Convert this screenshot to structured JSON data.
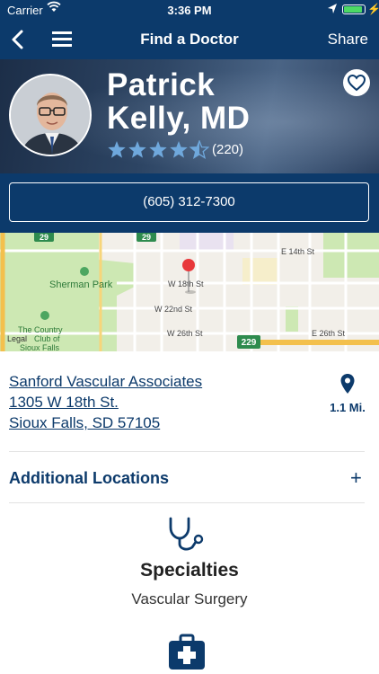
{
  "status_bar": {
    "carrier": "Carrier",
    "time": "3:36 PM"
  },
  "nav": {
    "title": "Find a Doctor",
    "share_label": "Share"
  },
  "doctor": {
    "name_line1": "Patrick",
    "name_line2": "Kelly, MD",
    "rating": 4.5,
    "rating_count": "(220)"
  },
  "phone": "(605) 312-7300",
  "map": {
    "streets": [
      "E 14th St",
      "W 18th St",
      "W 22nd St",
      "W 26th St",
      "E 26th St",
      "Sherman Park",
      "The Country",
      "Club of",
      "Sioux Falls",
      "Legal"
    ],
    "highway_shields": [
      "29",
      "29",
      "229"
    ]
  },
  "location": {
    "name": "Sanford Vascular Associates",
    "street": "1305 W 18th St.",
    "city": "Sioux Falls, SD 57105",
    "distance": "1.1 Mi."
  },
  "additional_locations_label": "Additional Locations",
  "specialties": {
    "title": "Specialties",
    "value": "Vascular Surgery"
  },
  "colors": {
    "primary": "#0c3a6b",
    "star": "#6fa8dc",
    "map_green": "#cde8b3"
  }
}
